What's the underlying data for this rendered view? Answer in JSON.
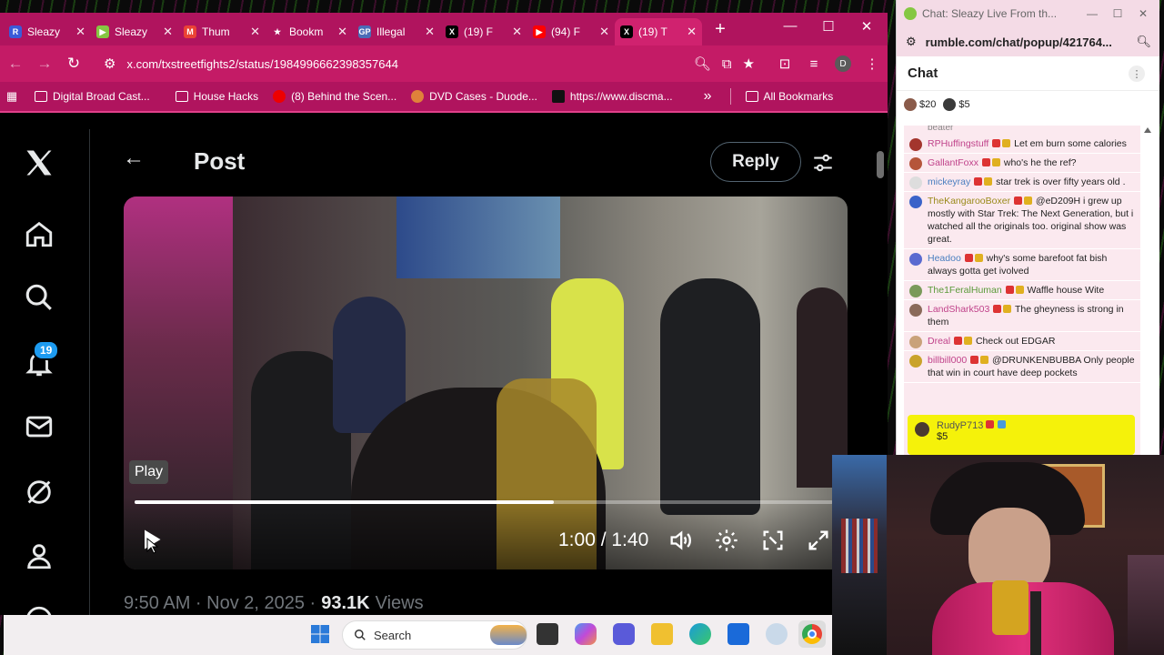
{
  "tabs": [
    {
      "label": "Sleazy",
      "favicon": "R",
      "color": "#3a5bd9",
      "active": false
    },
    {
      "label": "Sleazy",
      "favicon": "▶",
      "color": "#85c742",
      "active": false
    },
    {
      "label": "Thum",
      "favicon": "M",
      "color": "#ea4335",
      "active": false
    },
    {
      "label": "Bookm",
      "favicon": "★",
      "color": "transparent",
      "active": false
    },
    {
      "label": "Illegal",
      "favicon": "GP",
      "color": "#4b6cb7",
      "active": false
    },
    {
      "label": "(19) F",
      "favicon": "X",
      "color": "#000000",
      "active": false
    },
    {
      "label": "(94) F",
      "favicon": "▶",
      "color": "#ff0000",
      "active": false
    },
    {
      "label": "(19) T",
      "favicon": "X",
      "color": "#000000",
      "active": true
    }
  ],
  "address": {
    "url": "x.com/txstreetfights2/status/1984996662398357644",
    "profile_initial": "D"
  },
  "bookmarks": [
    {
      "label": "Digital Broad Cast...",
      "icon": "folder-icon"
    },
    {
      "label": "House Hacks",
      "icon": "folder-icon"
    },
    {
      "label": "(8) Behind the Scen...",
      "icon": "youtube-icon"
    },
    {
      "label": "DVD Cases - Duode...",
      "icon": "site-icon"
    },
    {
      "label": "https://www.discma...",
      "icon": "site-icon"
    }
  ],
  "bookmarks_more": "»",
  "all_bookmarks": "All Bookmarks",
  "twitter": {
    "notification_count": "19",
    "post_title": "Post",
    "reply_label": "Reply",
    "play_tooltip": "Play",
    "time_current": "1:00",
    "time_total": "1:40",
    "time_display": "1:00 / 1:40",
    "progress_fraction": 0.6,
    "posted_time": "9:50 AM · Nov 2, 2025 ·",
    "views_count": "93.1K",
    "views_label": "Views"
  },
  "chat": {
    "window_title": "Chat: Sleazy Live From th...",
    "url": "rumble.com/chat/popup/421764...",
    "header": "Chat",
    "tips": [
      "$20",
      "$5"
    ],
    "partial_top": "beater",
    "messages": [
      {
        "user": "RPHuffingstuff",
        "user_color": "#c0428a",
        "text": "Let em burn some calories",
        "avatar": "#a3352d"
      },
      {
        "user": "GallantFoxx",
        "user_color": "#c0428a",
        "text": "who's he the ref?",
        "avatar": "#b5553a"
      },
      {
        "user": "mickeyray",
        "user_color": "#4a7fc0",
        "text": "star trek is over fifty years old .",
        "avatar": "#ddd"
      },
      {
        "user": "TheKangarooBoxer",
        "user_color": "#9a8a1a",
        "text": "@eD209H i grew up mostly with Star Trek: The Next Generation, but i watched all the originals too. original show was great.",
        "avatar": "#3a63c9"
      },
      {
        "user": "Headoo",
        "user_color": "#4a7fc0",
        "text": "why's some barefoot fat bish always gotta get ivolved",
        "avatar": "#5a6ad0"
      },
      {
        "user": "The1FeralHuman",
        "user_color": "#5a9a3a",
        "text": "Waffle house Wite",
        "avatar": "#7a9a5a"
      },
      {
        "user": "LandShark503",
        "user_color": "#c0428a",
        "text": "The gheyness is strong in them",
        "avatar": "#8a6a5a"
      },
      {
        "user": "Dreal",
        "user_color": "#c0428a",
        "text": "Check out EDGAR",
        "avatar": "#c9a27a"
      },
      {
        "user": "billbill000",
        "user_color": "#c0428a",
        "text": "@DRUNKENBUBBA Only people that win in court have deep pockets",
        "avatar": "#c9a32a"
      }
    ],
    "rant_user": "RudyP713",
    "rant_amount": "$5"
  },
  "taskbar": {
    "search_placeholder": "Search"
  }
}
